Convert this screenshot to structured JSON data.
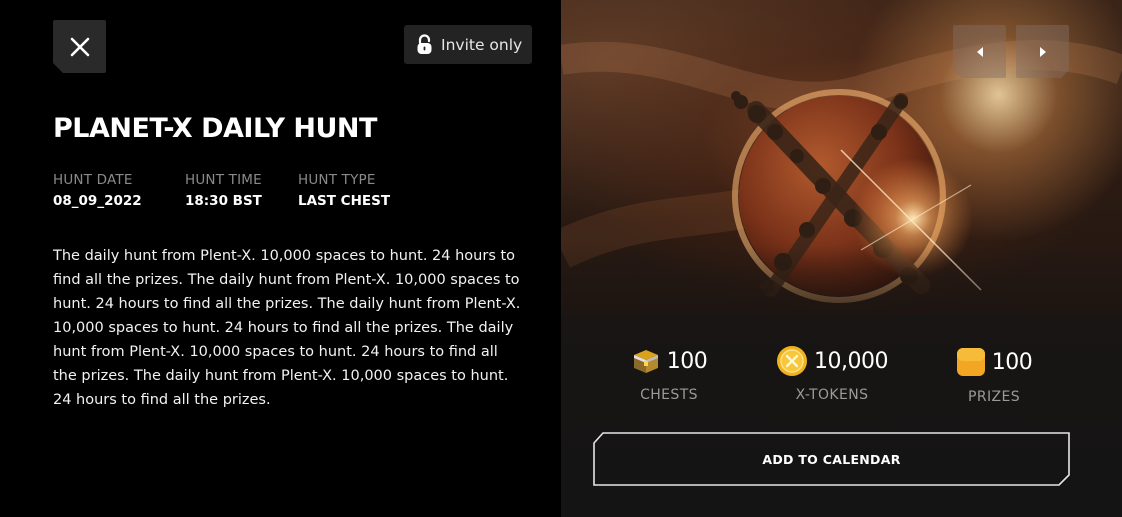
{
  "badge": {
    "label": "Invite only"
  },
  "title": "PLANET-X DAILY HUNT",
  "meta": [
    {
      "label": "HUNT DATE",
      "value": "08_09_2022"
    },
    {
      "label": "HUNT TIME",
      "value": "18:30 BST"
    },
    {
      "label": "HUNT TYPE",
      "value": "LAST CHEST"
    }
  ],
  "description": "The daily hunt from Plent-X. 10,000 spaces to hunt. 24 hours to find all the prizes. The daily hunt from Plent-X. 10,000 spaces to hunt. 24 hours to find all the prizes. The daily hunt from Plent-X. 10,000 spaces to hunt. 24 hours to find all the prizes. The daily hunt from Plent-X. 10,000 spaces to hunt. 24 hours to find all the prizes. The daily hunt from Plent-X. 10,000 spaces to hunt. 24 hours to find all the prizes.",
  "stats": [
    {
      "value": "100",
      "label": "CHESTS",
      "icon": "chest-icon"
    },
    {
      "value": "10,000",
      "label": "X-TOKENS",
      "icon": "x-token-icon"
    },
    {
      "value": "100",
      "label": "PRIZES",
      "icon": "prize-icon"
    }
  ],
  "calendar_button": "ADD TO CALENDAR",
  "icons": {
    "close": "close-icon",
    "lock": "lock-icon",
    "prev": "chevron-left-icon",
    "next": "chevron-right-icon"
  },
  "colors": {
    "accent_gold": "#f2a623",
    "muted_text": "#8a8a8a"
  }
}
